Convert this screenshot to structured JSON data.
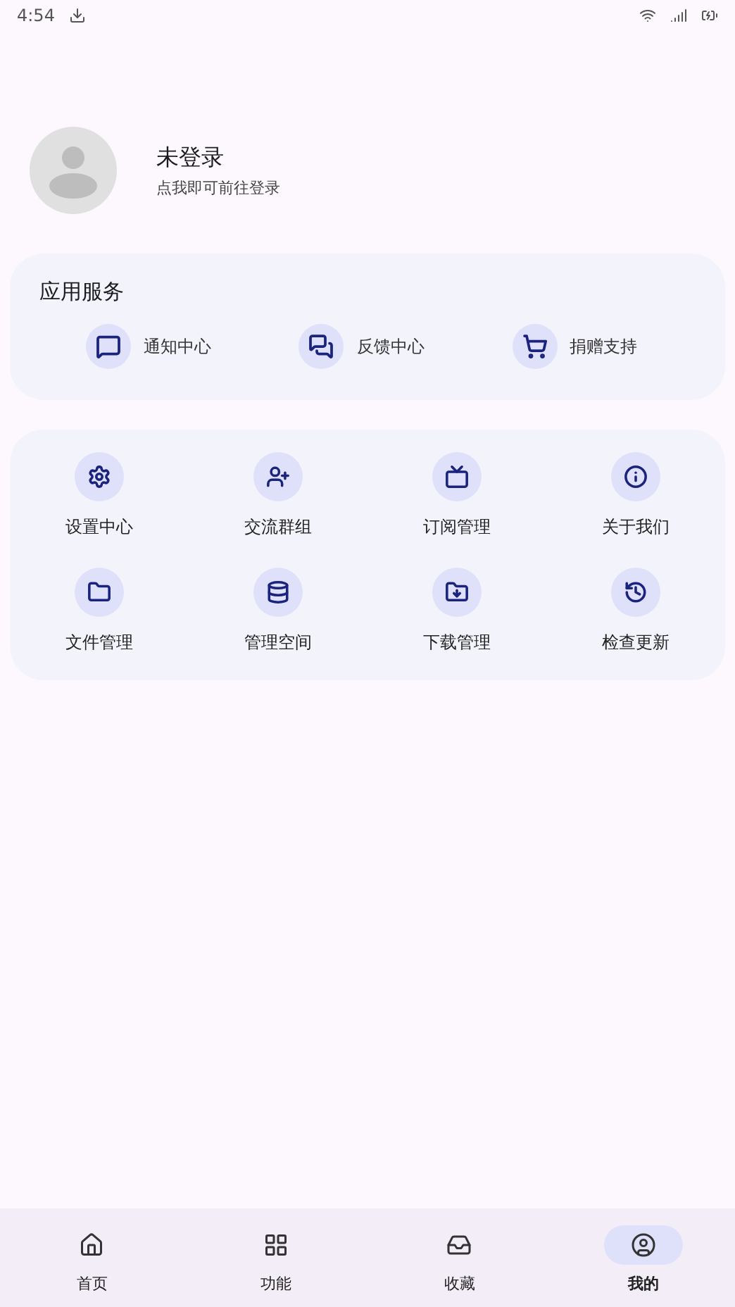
{
  "status_bar": {
    "time": "4:54"
  },
  "profile": {
    "name": "未登录",
    "hint": "点我即可前往登录"
  },
  "services": {
    "title": "应用服务",
    "items": [
      {
        "label": "通知中心"
      },
      {
        "label": "反馈中心"
      },
      {
        "label": "捐赠支持"
      }
    ]
  },
  "grid": [
    {
      "label": "设置中心"
    },
    {
      "label": "交流群组"
    },
    {
      "label": "订阅管理"
    },
    {
      "label": "关于我们"
    },
    {
      "label": "文件管理"
    },
    {
      "label": "管理空间"
    },
    {
      "label": "下载管理"
    },
    {
      "label": "检查更新"
    }
  ],
  "bottom_nav": [
    {
      "label": "首页",
      "selected": false
    },
    {
      "label": "功能",
      "selected": false
    },
    {
      "label": "收藏",
      "selected": false
    },
    {
      "label": "我的",
      "selected": true
    }
  ]
}
